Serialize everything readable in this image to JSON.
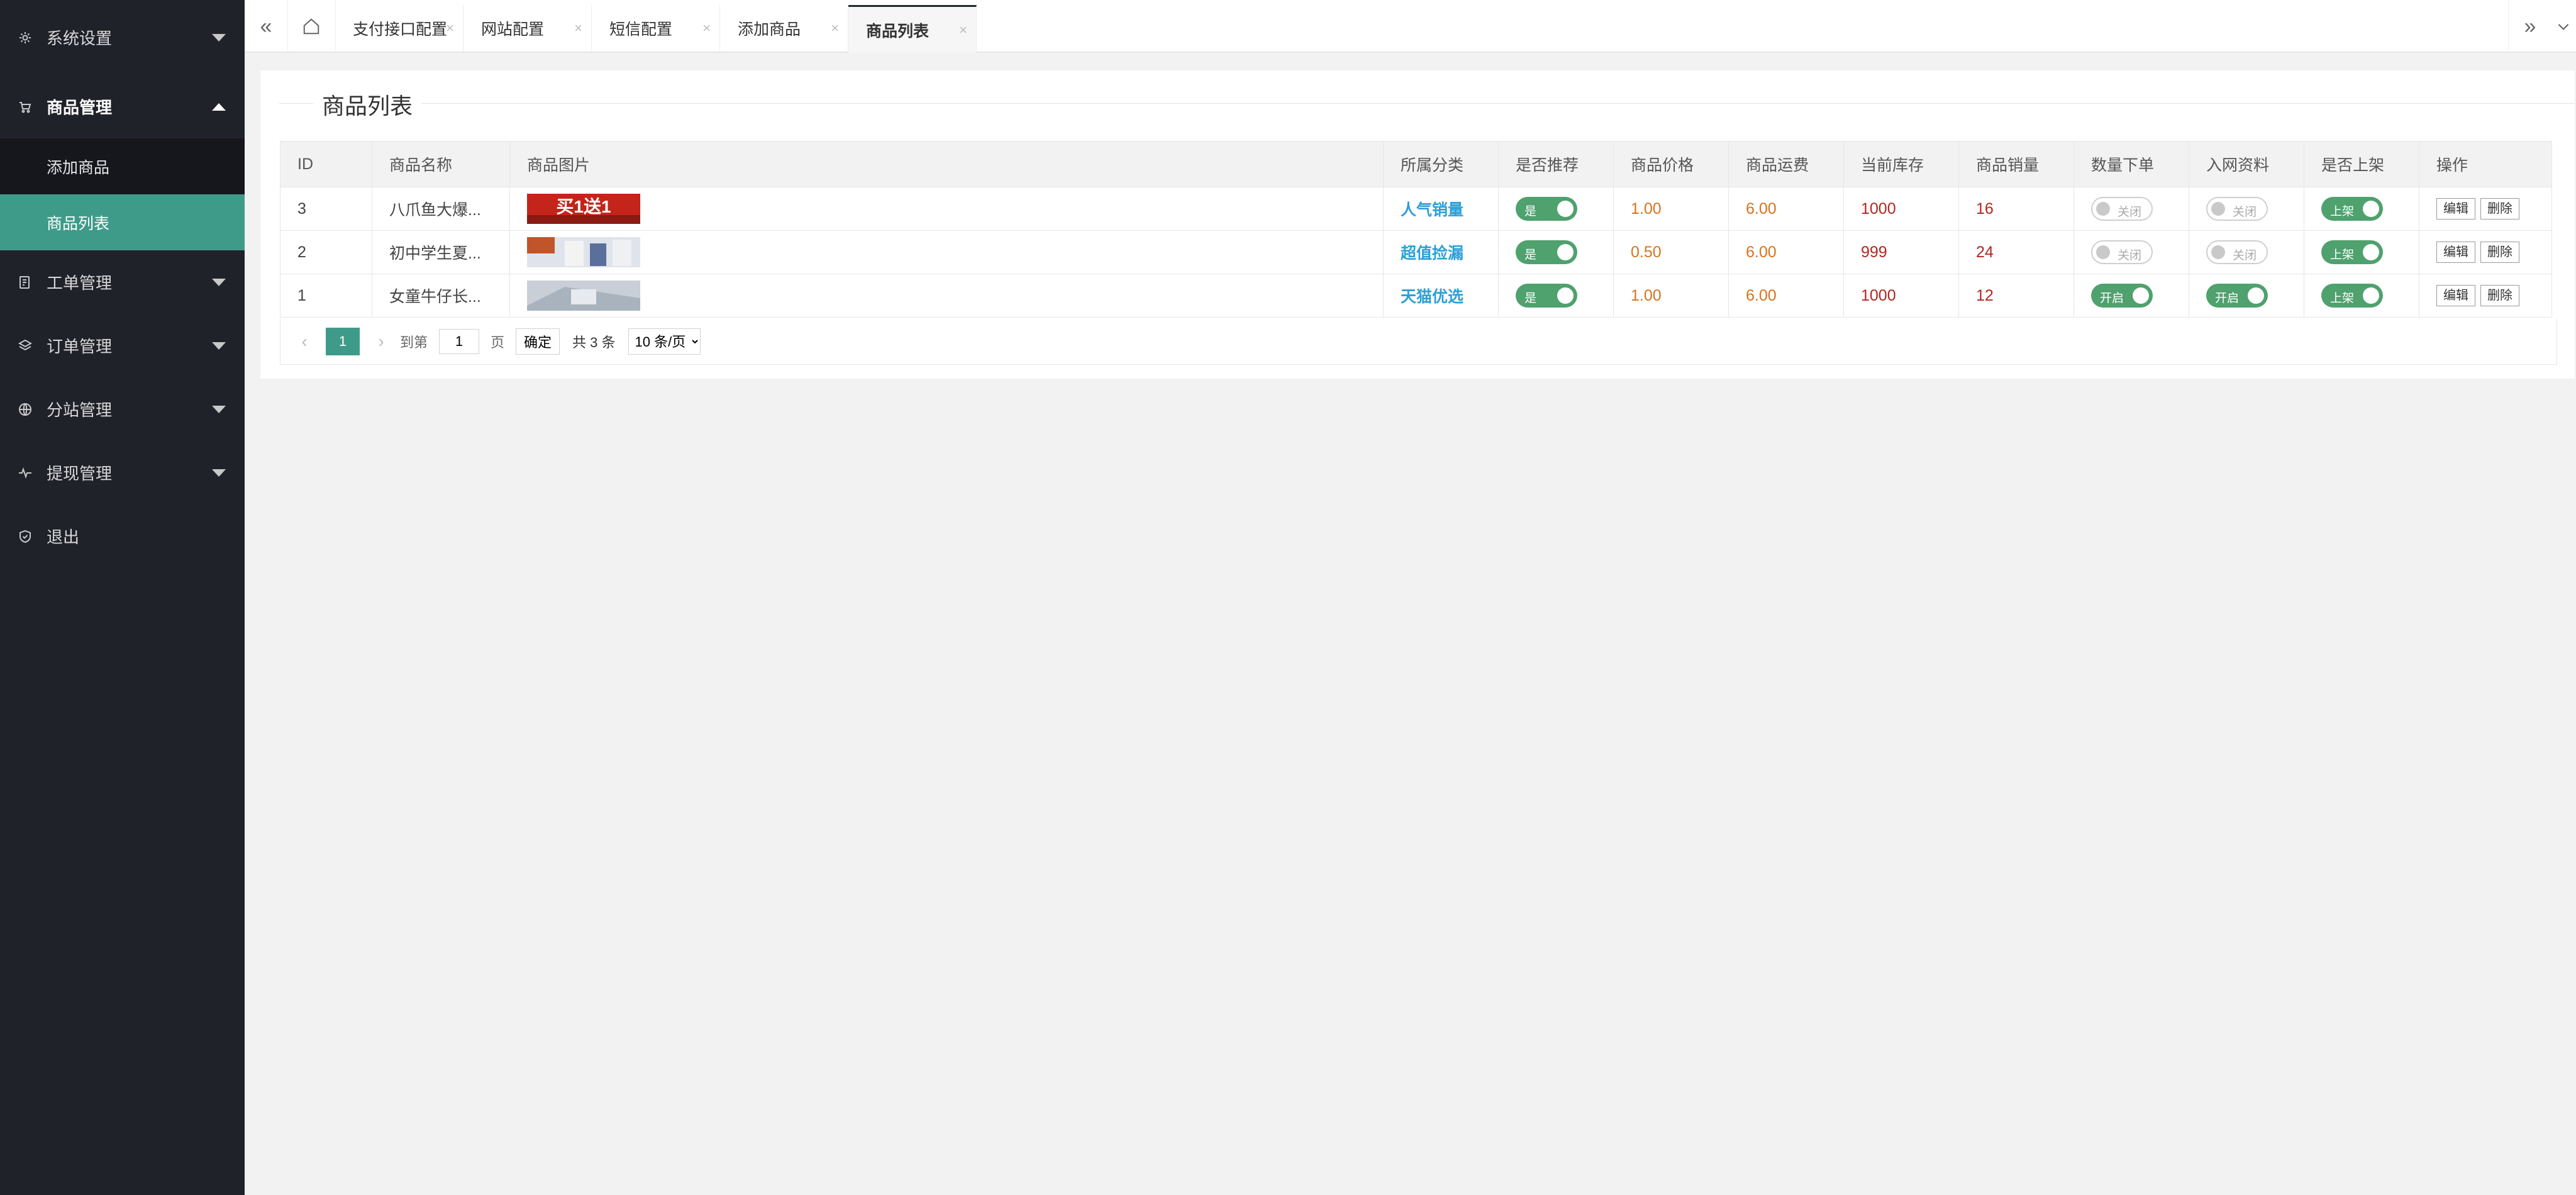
{
  "sidebar": {
    "items": [
      {
        "label": "系统设置",
        "icon": "gear-icon"
      },
      {
        "label": "商品管理",
        "icon": "cart-icon",
        "open": true,
        "children": [
          {
            "label": "添加商品"
          },
          {
            "label": "商品列表",
            "active": true
          }
        ]
      },
      {
        "label": "工单管理",
        "icon": "ticket-icon"
      },
      {
        "label": "订单管理",
        "icon": "layers-icon"
      },
      {
        "label": "分站管理",
        "icon": "globe-icon"
      },
      {
        "label": "提现管理",
        "icon": "pulse-icon"
      },
      {
        "label": "退出",
        "icon": "shield-icon"
      }
    ]
  },
  "tabs": [
    {
      "label": "支付接口配置"
    },
    {
      "label": "网站配置"
    },
    {
      "label": "短信配置"
    },
    {
      "label": "添加商品"
    },
    {
      "label": "商品列表",
      "active": true
    }
  ],
  "tab_close_glyph": "×",
  "panel": {
    "title": "商品列表"
  },
  "table": {
    "headers": [
      "ID",
      "商品名称",
      "商品图片",
      "所属分类",
      "是否推荐",
      "商品价格",
      "商品运费",
      "当前库存",
      "商品销量",
      "数量下单",
      "入网资料",
      "是否上架",
      "操作"
    ],
    "rows": [
      {
        "id": "3",
        "name": "八爪鱼大爆...",
        "image_caption": "买1送1",
        "category": "人气销量",
        "recommend": "是",
        "price": "1.00",
        "shipping": "6.00",
        "stock": "1000",
        "sales": "16",
        "qty_order": "关闭",
        "qty_order_on": false,
        "net_info": "关闭",
        "net_info_on": false,
        "listed": "上架"
      },
      {
        "id": "2",
        "name": "初中学生夏...",
        "image_caption": "",
        "category": "超值捡漏",
        "recommend": "是",
        "price": "0.50",
        "shipping": "6.00",
        "stock": "999",
        "sales": "24",
        "qty_order": "关闭",
        "qty_order_on": false,
        "net_info": "关闭",
        "net_info_on": false,
        "listed": "上架"
      },
      {
        "id": "1",
        "name": "女童牛仔长...",
        "image_caption": "",
        "category": "天猫优选",
        "recommend": "是",
        "price": "1.00",
        "shipping": "6.00",
        "stock": "1000",
        "sales": "12",
        "qty_order": "开启",
        "qty_order_on": true,
        "net_info": "开启",
        "net_info_on": true,
        "listed": "上架"
      }
    ],
    "edit_label": "编辑",
    "delete_label": "删除"
  },
  "pager": {
    "current": "1",
    "goto_label": "到第",
    "page_value": "1",
    "page_label": "页",
    "confirm_label": "确定",
    "total_label": "共 3 条",
    "per_page": "10 条/页"
  },
  "colors": {
    "sidebar_bg": "#20222a",
    "accent": "#3f9b89",
    "switch_on": "#4fa16d",
    "link": "#2d9fd6",
    "price": "#d9731a",
    "stock": "#b3261e"
  }
}
